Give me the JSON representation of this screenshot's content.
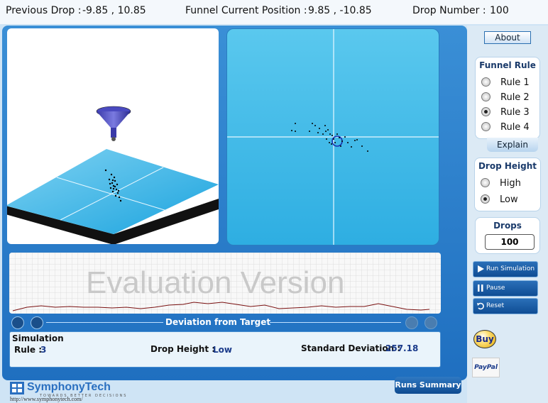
{
  "header": {
    "previous_drop_label": "Previous Drop :",
    "previous_drop_value": "-9.85 , 10.85",
    "funnel_position_label": "Funnel Current Position :",
    "funnel_position_value": "9.85 , -10.85",
    "drop_number_label": "Drop Number :",
    "drop_number_value": "100"
  },
  "chart": {
    "watermark": "Evaluation Version",
    "title": "Deviation from Target"
  },
  "summary": {
    "heading": "Simulation",
    "rule_label": "Rule :",
    "rule_value": "3",
    "drop_height_label": "Drop Height :",
    "drop_height_value": "Low",
    "std_label": "Standard Deviation :",
    "std_value": "257.18"
  },
  "sidebar": {
    "about": "About",
    "funnel_rule": {
      "title": "Funnel Rule",
      "options": [
        "Rule 1",
        "Rule 2",
        "Rule 3",
        "Rule 4"
      ],
      "selected": 2,
      "explain": "Explain"
    },
    "drop_height": {
      "title": "Drop Height",
      "options": [
        "High",
        "Low"
      ],
      "selected": 1
    },
    "drops": {
      "title": "Drops",
      "value": "100"
    },
    "controls": {
      "run": "Run Simulation",
      "pause": "Pause",
      "reset": "Reset"
    },
    "buy": "Buy",
    "paypal": "PayPal"
  },
  "footer": {
    "runs_summary": "Runs Summary",
    "brand": "SymphonyTech",
    "tagline": "TOWARDS BETTER DECISIONS",
    "url": "http://www.symphonytech.com/"
  },
  "colors": {
    "accent": "#1f6fc0",
    "panel_blue": "#2eaee2"
  }
}
